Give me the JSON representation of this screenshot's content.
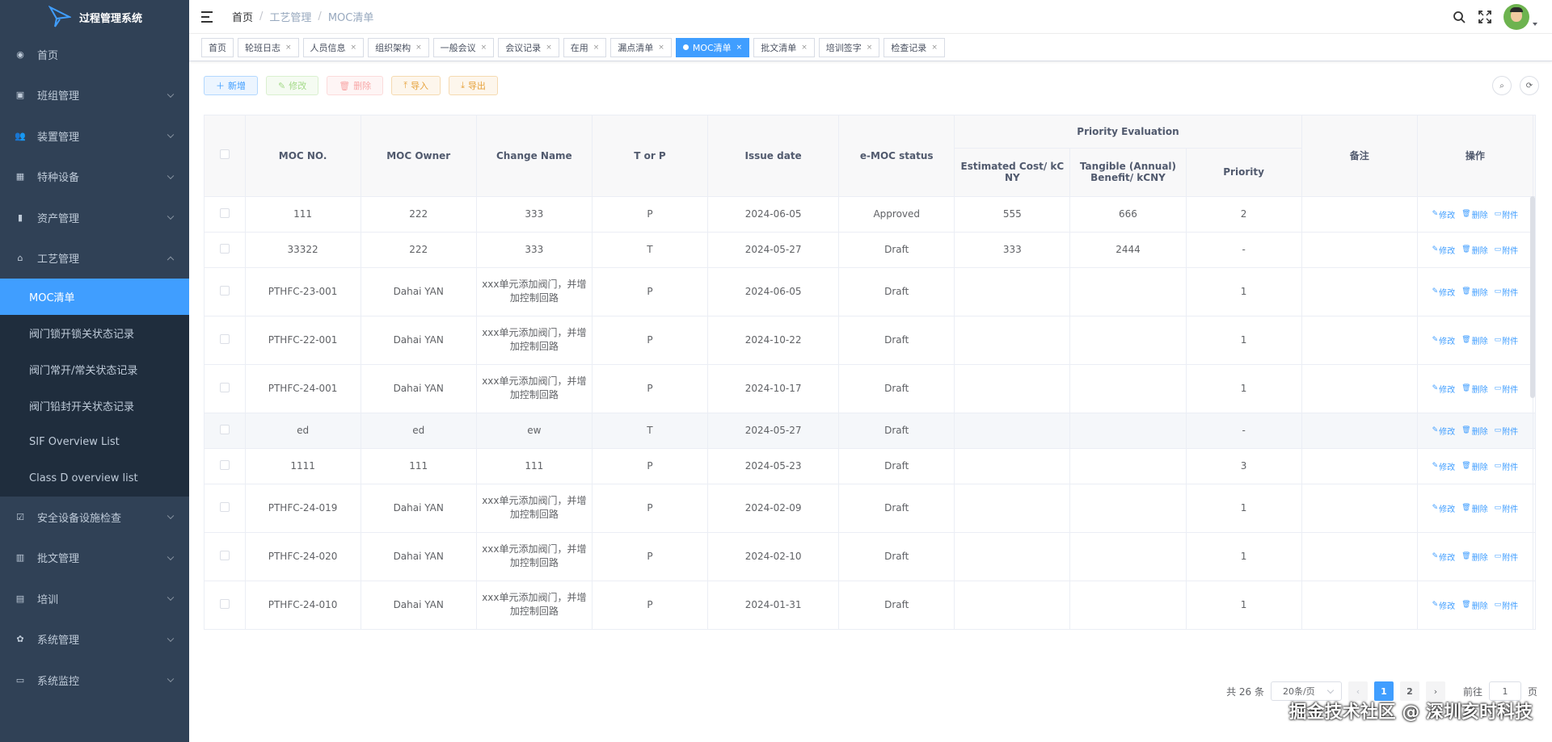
{
  "app": {
    "title": "过程管理系统"
  },
  "sidebar": {
    "items": [
      {
        "label": "首页",
        "icon": "dashboard-icon"
      },
      {
        "label": "班组管理",
        "icon": "group-icon"
      },
      {
        "label": "装置管理",
        "icon": "user-icon"
      },
      {
        "label": "特种设备",
        "icon": "grid-icon"
      },
      {
        "label": "资产管理",
        "icon": "chart-icon"
      },
      {
        "label": "工艺管理",
        "icon": "process-icon"
      }
    ],
    "submenu": [
      {
        "label": "MOC清单",
        "active": true
      },
      {
        "label": "阀门锁开锁关状态记录"
      },
      {
        "label": "阀门常开/常关状态记录"
      },
      {
        "label": "阀门铅封开关状态记录"
      },
      {
        "label": "SIF Overview List"
      },
      {
        "label": "Class D overview list"
      }
    ],
    "items_after": [
      {
        "label": "安全设备设施检查",
        "icon": "checkbox-icon"
      },
      {
        "label": "批文管理",
        "icon": "book-icon"
      },
      {
        "label": "培训",
        "icon": "training-icon"
      },
      {
        "label": "系统管理",
        "icon": "gear-icon"
      },
      {
        "label": "系统监控",
        "icon": "monitor-icon"
      }
    ]
  },
  "breadcrumb": [
    "首页",
    "工艺管理",
    "MOC清单"
  ],
  "tags": [
    {
      "label": "首页",
      "closable": false
    },
    {
      "label": "轮班日志",
      "closable": true
    },
    {
      "label": "人员信息",
      "closable": true
    },
    {
      "label": "组织架构",
      "closable": true
    },
    {
      "label": "一般会议",
      "closable": true
    },
    {
      "label": "会议记录",
      "closable": true
    },
    {
      "label": "在用",
      "closable": true
    },
    {
      "label": "漏点清单",
      "closable": true
    },
    {
      "label": "MOC清单",
      "closable": true,
      "active": true
    },
    {
      "label": "批文清单",
      "closable": true
    },
    {
      "label": "培训签字",
      "closable": true
    },
    {
      "label": "检查记录",
      "closable": true
    }
  ],
  "toolbar": {
    "add": "新增",
    "edit": "修改",
    "delete": "删除",
    "import": "导入",
    "export": "导出"
  },
  "table": {
    "headers": {
      "moc_no": "MOC NO.",
      "owner": "MOC Owner",
      "change_name": "Change Name",
      "t_or_p": "T or P",
      "issue_date": "Issue date",
      "status": "e-MOC status",
      "priority_eval": "Priority Evaluation",
      "est_cost": "Estimated Cost/ kCNY",
      "tangible": "Tangible (Annual) Benefit/ kCNY",
      "priority": "Priority",
      "remark": "备注",
      "ops": "操作"
    },
    "ops": {
      "edit": "修改",
      "delete": "删除",
      "attach": "附件"
    },
    "rows": [
      {
        "moc": "111",
        "owner": "222",
        "name": "333",
        "tp": "P",
        "date": "2024-06-05",
        "status": "Approved",
        "cost": "555",
        "benefit": "666",
        "priority": "2",
        "remark": ""
      },
      {
        "moc": "33322",
        "owner": "222",
        "name": "333",
        "tp": "T",
        "date": "2024-05-27",
        "status": "Draft",
        "cost": "333",
        "benefit": "2444",
        "priority": "-",
        "remark": ""
      },
      {
        "moc": "PTHFC-23-001",
        "owner": "Dahai YAN",
        "name": "xxx单元添加阀门，并增加控制回路",
        "tp": "P",
        "date": "2024-06-05",
        "status": "Draft",
        "cost": "",
        "benefit": "",
        "priority": "1",
        "remark": ""
      },
      {
        "moc": "PTHFC-22-001",
        "owner": "Dahai YAN",
        "name": "xxx单元添加阀门，并增加控制回路",
        "tp": "P",
        "date": "2024-10-22",
        "status": "Draft",
        "cost": "",
        "benefit": "",
        "priority": "1",
        "remark": ""
      },
      {
        "moc": "PTHFC-24-001",
        "owner": "Dahai YAN",
        "name": "xxx单元添加阀门，并增加控制回路",
        "tp": "P",
        "date": "2024-10-17",
        "status": "Draft",
        "cost": "",
        "benefit": "",
        "priority": "1",
        "remark": ""
      },
      {
        "moc": "ed",
        "owner": "ed",
        "name": "ew",
        "tp": "T",
        "date": "2024-05-27",
        "status": "Draft",
        "cost": "",
        "benefit": "",
        "priority": "-",
        "remark": ""
      },
      {
        "moc": "1111",
        "owner": "111",
        "name": "111",
        "tp": "P",
        "date": "2024-05-23",
        "status": "Draft",
        "cost": "",
        "benefit": "",
        "priority": "3",
        "remark": ""
      },
      {
        "moc": "PTHFC-24-019",
        "owner": "Dahai YAN",
        "name": "xxx单元添加阀门，并增加控制回路",
        "tp": "P",
        "date": "2024-02-09",
        "status": "Draft",
        "cost": "",
        "benefit": "",
        "priority": "1",
        "remark": ""
      },
      {
        "moc": "PTHFC-24-020",
        "owner": "Dahai YAN",
        "name": "xxx单元添加阀门，并增加控制回路",
        "tp": "P",
        "date": "2024-02-10",
        "status": "Draft",
        "cost": "",
        "benefit": "",
        "priority": "1",
        "remark": ""
      },
      {
        "moc": "PTHFC-24-010",
        "owner": "Dahai YAN",
        "name": "xxx单元添加阀门，并增加控制回路",
        "tp": "P",
        "date": "2024-01-31",
        "status": "Draft",
        "cost": "",
        "benefit": "",
        "priority": "1",
        "remark": ""
      }
    ]
  },
  "pagination": {
    "total": "共 26 条",
    "page_size": "20条/页",
    "pages": [
      "1",
      "2"
    ],
    "current": "1",
    "goto_label": "前往",
    "goto_value": "1",
    "page_unit": "页"
  },
  "watermark": "掘金技术社区 @ 深圳亥时科技",
  "colors": {
    "sidebar_bg": "#304156",
    "accent": "#409eff"
  }
}
